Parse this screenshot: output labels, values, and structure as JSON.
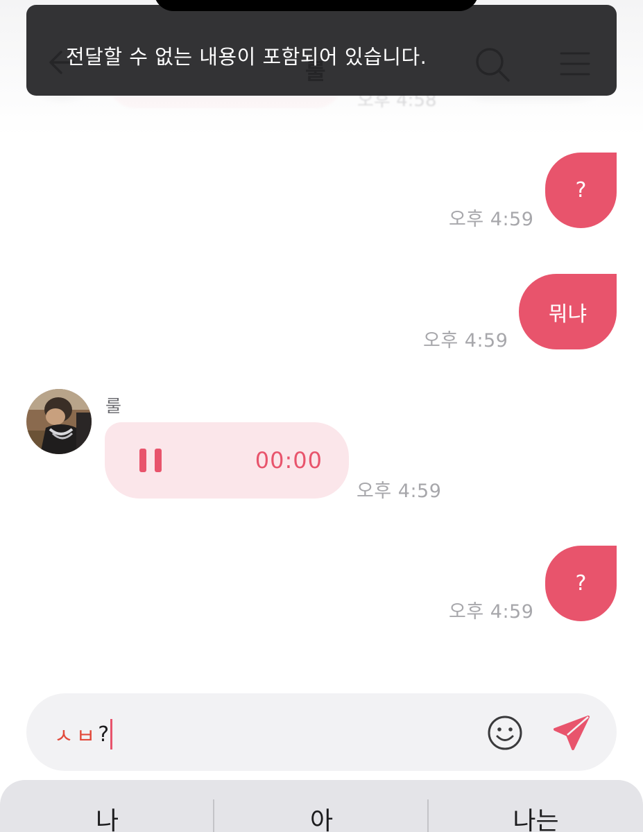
{
  "toast": {
    "message": "전달할 수 없는 내용이 포함되어 있습니다."
  },
  "header": {
    "title": "룰",
    "ghost_time": "오후 4:58",
    "back_icon": "arrow-left-icon",
    "search_icon": "search-icon",
    "menu_icon": "hamburger-menu-icon"
  },
  "messages": [
    {
      "side": "out",
      "text": "?",
      "time": "오후 4:59"
    },
    {
      "side": "out",
      "text": "뭐냐",
      "time": "오후 4:59"
    },
    {
      "side": "in",
      "sender": "룰",
      "type": "voice",
      "duration": "00:00",
      "time": "오후 4:59"
    },
    {
      "side": "out",
      "text": "?",
      "time": "오후 4:59"
    }
  ],
  "input": {
    "composing": "ㅅㅂ",
    "typed": "?",
    "emoji_icon": "smiley-face-icon",
    "send_icon": "send-paper-plane-icon"
  },
  "keyboard": {
    "suggestions": [
      "나",
      "아",
      "나는"
    ]
  },
  "colors": {
    "accent": "#e8546c",
    "voice_bubble": "#fbe6ea",
    "toast_bg": "#262628",
    "time": "#a7a7ab"
  }
}
